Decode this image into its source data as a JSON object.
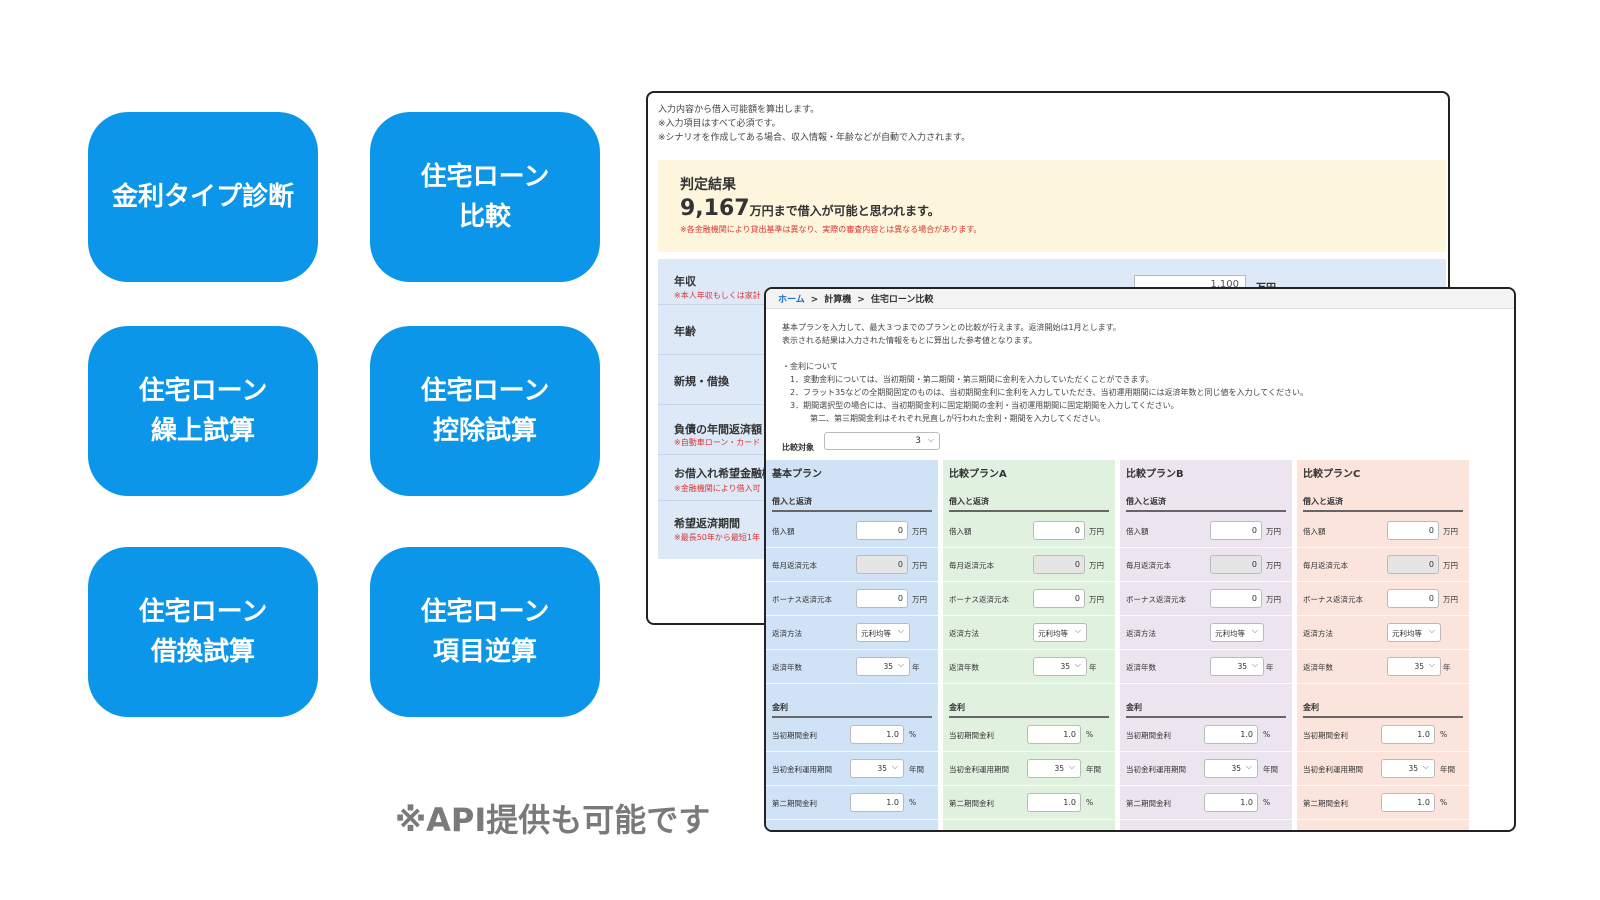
{
  "tiles": [
    {
      "line1": "金利タイプ診断",
      "line2": ""
    },
    {
      "line1": "住宅ローン",
      "line2": "比較"
    },
    {
      "line1": "住宅ローン",
      "line2": "繰上試算"
    },
    {
      "line1": "住宅ローン",
      "line2": "控除試算"
    },
    {
      "line1": "住宅ローン",
      "line2": "借換試算"
    },
    {
      "line1": "住宅ローン",
      "line2": "項目逆算"
    }
  ],
  "api_note": "※API提供も可能です",
  "back_window": {
    "intro": [
      "入力内容から借入可能額を算出します。",
      "※入力項目はすべて必須です。",
      "※シナリオを作成してある場合、収入情報・年齢などが自動で入力されます。"
    ],
    "result": {
      "title": "判定結果",
      "amount": "9,167",
      "tail": "万円まで借入が可能と思われます。",
      "note": "※各金融機関により貸出基準は異なり、実際の審査内容とは異なる場合があります。"
    },
    "rows": [
      {
        "label": "年収",
        "note": "※本人年収もしくは家計"
      },
      {
        "label": "年齢",
        "note": ""
      },
      {
        "label": "新規・借換",
        "note": ""
      },
      {
        "label": "負債の年間返済額",
        "note": "※自動車ローン・カード"
      },
      {
        "label": "お借入れ希望金融機",
        "note": "※金融機関により借入可"
      },
      {
        "label": "希望返済期間",
        "note": "※最長50年から最短1年"
      }
    ],
    "annual_income_value": "1,100",
    "annual_income_unit": "万円"
  },
  "front_window": {
    "breadcrumb": {
      "home": "ホーム",
      "sep": ">",
      "calc": "計算機",
      "current": "住宅ローン比較"
    },
    "intro": [
      "基本プランを入力して、最大３つまでのプランとの比較が行えます。返済開始は1月とします。",
      "表示される結果は入力された情報をもとに算出した参考値となります。",
      "",
      "・金利について",
      "1．変動金利については、当初期間・第二期間・第三期間に金利を入力していただくことができます。",
      "2．フラット35などの全期間固定のものは、当初期間金利に金利を入力していただき、当初運用期間には返済年数と同じ値を入力してください。",
      "3．期間選択型の場合には、当初期間金利に固定期間の金利・当初運用期間に固定期間を入力してください。",
      "第二、第三期間金利はそれぞれ見直しが行われた金利・期間を入力してください。"
    ],
    "compare_label": "比較対象",
    "compare_value": "3",
    "section_loan": "借入と返済",
    "section_rate": "金利",
    "labels": {
      "borrow": "借入額",
      "monthly_principal": "毎月返済元本",
      "bonus_principal": "ボーナス返済元本",
      "method": "返済方法",
      "years": "返済年数",
      "initial_rate": "当初期間金利",
      "initial_period": "当初金利運用期間",
      "second_rate": "第二期間金利"
    },
    "units": {
      "man_yen": "万円",
      "year": "年",
      "percent": "%",
      "years": "年間"
    },
    "plans": [
      {
        "name": "基本プラン",
        "color": "#cfe2f6",
        "borrow": "0",
        "monthly": "0",
        "bonus": "0",
        "method": "元利均等",
        "years": "35",
        "initial_rate": "1.0",
        "initial_period": "35",
        "second_rate": "1.0"
      },
      {
        "name": "比較プランA",
        "color": "#e1f1df",
        "borrow": "0",
        "monthly": "0",
        "bonus": "0",
        "method": "元利均等",
        "years": "35",
        "initial_rate": "1.0",
        "initial_period": "35",
        "second_rate": "1.0"
      },
      {
        "name": "比較プランB",
        "color": "#ece4ee",
        "borrow": "0",
        "monthly": "0",
        "bonus": "0",
        "method": "元利均等",
        "years": "35",
        "initial_rate": "1.0",
        "initial_period": "35",
        "second_rate": "1.0"
      },
      {
        "name": "比較プランC",
        "color": "#fbe4dc",
        "borrow": "0",
        "monthly": "0",
        "bonus": "0",
        "method": "元利均等",
        "years": "35",
        "initial_rate": "1.0",
        "initial_period": "35",
        "second_rate": "1.0"
      }
    ]
  }
}
